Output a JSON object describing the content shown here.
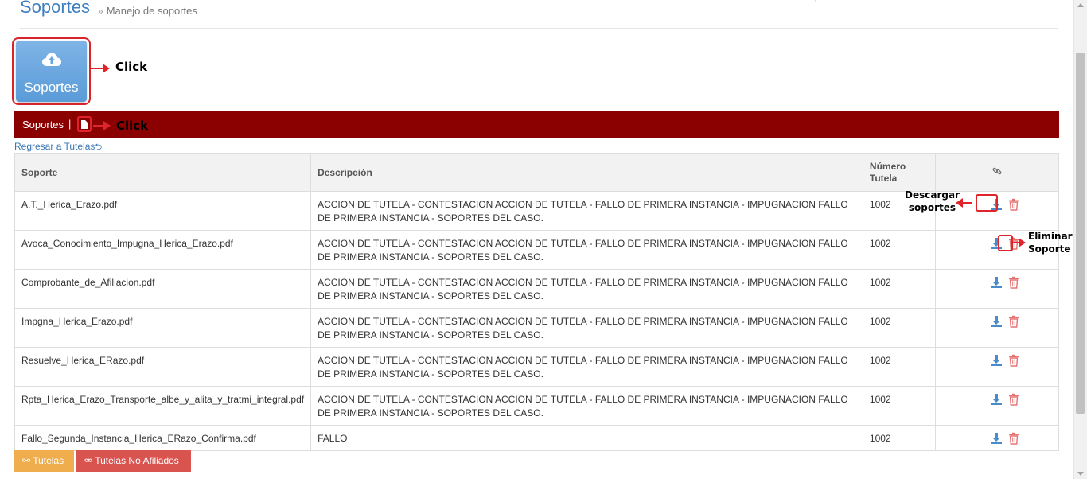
{
  "header": {
    "title": "Soportes",
    "breadcrumb_sep": "»",
    "breadcrumb": "Manejo de soportes"
  },
  "big_button": {
    "label": "Soportes",
    "icon": "cloud-upload-icon"
  },
  "annotations": {
    "click_1": "Click",
    "click_2": "Click",
    "download_1": "Descargar",
    "download_2": "soportes",
    "delete_1": "Eliminar",
    "delete_2": "Soporte"
  },
  "red_bar": {
    "label": "Soportes",
    "sep": "|",
    "icon": "document-icon"
  },
  "back_link": "Regresar a Tutelas",
  "table": {
    "headers": {
      "soporte": "Soporte",
      "descripcion": "Descripción",
      "numero_1": "Número",
      "numero_2": "Tutela",
      "links_icon": "link-icon"
    },
    "rows": [
      {
        "soporte": "A.T._Herica_Erazo.pdf",
        "descripcion": "ACCION DE TUTELA - CONTESTACION ACCION DE TUTELA - FALLO DE PRIMERA INSTANCIA - IMPUGNACION FALLO DE PRIMERA INSTANCIA - SOPORTES DEL CASO.",
        "numero": "1002"
      },
      {
        "soporte": "Avoca_Conocimiento_Impugna_Herica_Erazo.pdf",
        "descripcion": "ACCION DE TUTELA - CONTESTACION ACCION DE TUTELA - FALLO DE PRIMERA INSTANCIA - IMPUGNACION FALLO DE PRIMERA INSTANCIA - SOPORTES DEL CASO.",
        "numero": "1002"
      },
      {
        "soporte": "Comprobante_de_Afiliacion.pdf",
        "descripcion": "ACCION DE TUTELA - CONTESTACION ACCION DE TUTELA - FALLO DE PRIMERA INSTANCIA - IMPUGNACION FALLO DE PRIMERA INSTANCIA - SOPORTES DEL CASO.",
        "numero": "1002"
      },
      {
        "soporte": "Impgna_Herica_Erazo.pdf",
        "descripcion": "ACCION DE TUTELA - CONTESTACION ACCION DE TUTELA - FALLO DE PRIMERA INSTANCIA - IMPUGNACION FALLO DE PRIMERA INSTANCIA - SOPORTES DEL CASO.",
        "numero": "1002"
      },
      {
        "soporte": "Resuelve_Herica_ERazo.pdf",
        "descripcion": "ACCION DE TUTELA - CONTESTACION ACCION DE TUTELA - FALLO DE PRIMERA INSTANCIA - IMPUGNACION FALLO DE PRIMERA INSTANCIA - SOPORTES DEL CASO.",
        "numero": "1002"
      },
      {
        "soporte": "Rpta_Herica_Erazo_Transporte_albe_y_alita_y_tratmi_integral.pdf",
        "descripcion": "ACCION DE TUTELA - CONTESTACION ACCION DE TUTELA - FALLO DE PRIMERA INSTANCIA - IMPUGNACION FALLO DE PRIMERA INSTANCIA - SOPORTES DEL CASO.",
        "numero": "1002"
      },
      {
        "soporte": "Fallo_Segunda_Instancia_Herica_ERazo_Confirma.pdf",
        "descripcion": "FALLO",
        "numero": "1002"
      }
    ],
    "action_icons": {
      "download": "download-icon",
      "delete": "trash-icon"
    }
  },
  "footer_buttons": {
    "tutelas": "Tutelas",
    "no_afiliados": "Tutelas No Afiliados"
  },
  "colors": {
    "accent_blue": "#3f7fbf",
    "bar_red": "#8b0000",
    "annotation_red": "#e0242c",
    "btn_orange": "#f0ad4e",
    "btn_red": "#d9534f"
  }
}
